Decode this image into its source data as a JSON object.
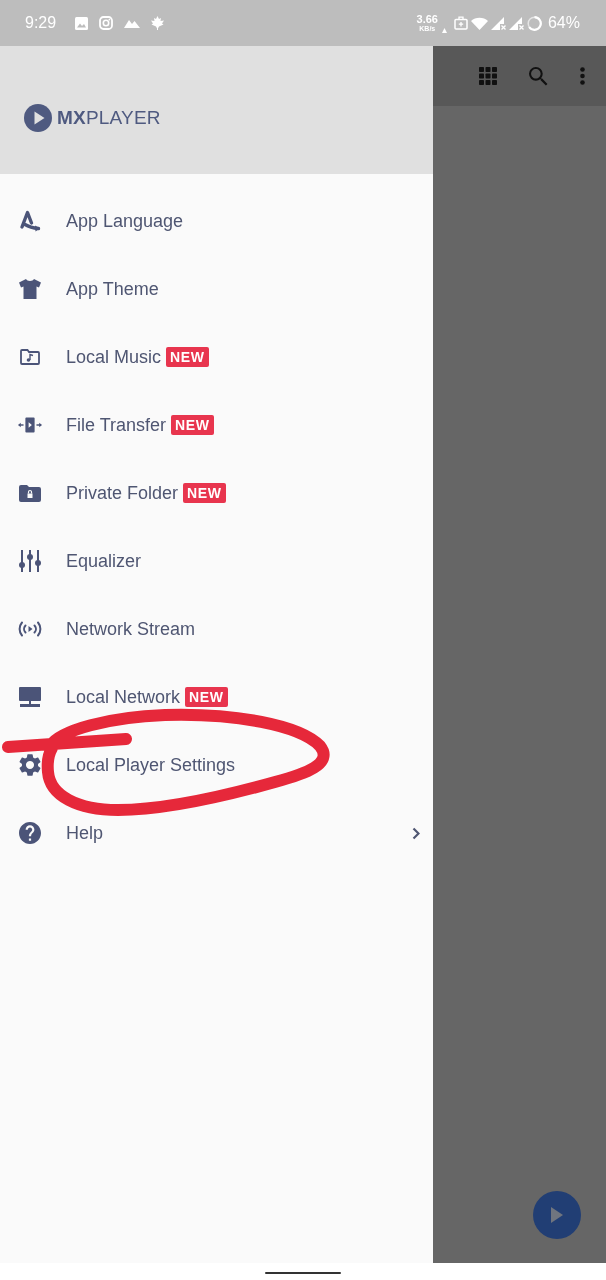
{
  "status_bar": {
    "time": "9:29",
    "net_speed": "3.66",
    "net_speed_unit": "KB/s",
    "battery": "64%"
  },
  "drawer": {
    "logo_text": "**MX**PLAYER",
    "items": [
      {
        "label": "App Language",
        "submenu": false
      },
      {
        "label": "App Theme",
        "submenu": false
      },
      {
        "label": "Local Music",
        "badge": "NEW",
        "submenu": false
      },
      {
        "label": "File Transfer",
        "badge": "NEW",
        "submenu": false
      },
      {
        "label": "Private Folder",
        "badge": "NEW",
        "submenu": false
      },
      {
        "label": "Equalizer",
        "submenu": false
      },
      {
        "label": "Network Stream",
        "submenu": false
      },
      {
        "label": "Local Network",
        "badge": "NEW",
        "submenu": false
      },
      {
        "label": "Local Player Settings",
        "submenu": false
      },
      {
        "label": "Help",
        "submenu": true
      }
    ]
  }
}
